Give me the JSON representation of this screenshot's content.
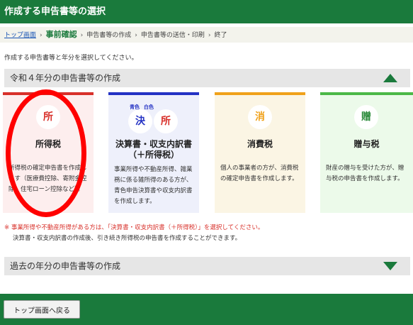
{
  "header": {
    "title": "作成する申告書等の選択"
  },
  "breadcrumb": {
    "items": [
      "トップ画面",
      "事前確認",
      "申告書等の作成",
      "申告書等の送信・印刷",
      "終了"
    ],
    "separator": "›"
  },
  "instruction": "作成する申告書等と年分を選択してください。",
  "current_section": {
    "title": "令和４年分の申告書等の作成"
  },
  "cards": [
    {
      "badge": "所",
      "title": "所得税",
      "desc": [
        "所得税の確定申告書を作成し",
        "ます（医療費控除、寄附金控",
        "除、住宅ローン控除など）。"
      ],
      "color": "#d8302a"
    },
    {
      "labels": [
        "青色",
        "白色"
      ],
      "badges": [
        "決",
        "所"
      ],
      "title_lines": [
        "決算書・収支内訳書",
        "（＋所得税）"
      ],
      "desc": [
        "事業所得や不動産所得、雑業",
        "務に係る雑所得のある方が、",
        "青色申告決算書や収支内訳書",
        "を作成します。"
      ],
      "color": "#2432c4"
    },
    {
      "badge": "消",
      "title": "消費税",
      "desc": [
        "個人の事業者の方が、消費税",
        "の確定申告書を作成します。"
      ],
      "color": "#f0a11a"
    },
    {
      "badge": "贈",
      "title": "贈与税",
      "desc": [
        "財産の贈与を受けた方が、贈",
        "与税の申告書を作成します。"
      ],
      "color": "#4bb847"
    }
  ],
  "note": {
    "line1_prefix": "※ 事業所得や不動産所得がある方は、",
    "line1_emph": "「決算書・収支内訳書（＋所得税）」",
    "line1_suffix": "を選択してください。",
    "line2": "決算書・収支内訳書の作成後、引き続き所得税の申告書を作成することができます。"
  },
  "past_section": {
    "title": "過去の年分の申告書等の作成"
  },
  "footer": {
    "back_label": "トップ画面へ戻る"
  }
}
